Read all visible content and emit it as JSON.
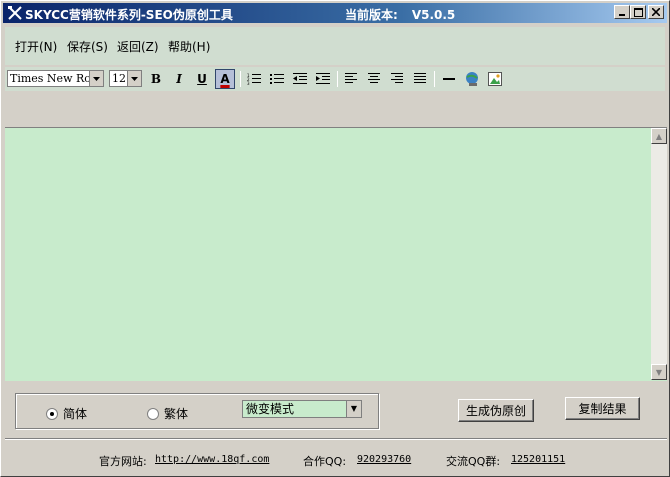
{
  "titlebar": {
    "title": "SKYCC营销软件系列-SEO伪原创工具",
    "version_label": "当前版本:",
    "version_value": "V5.0.5",
    "icon": "tools-icon"
  },
  "menu": {
    "items": [
      {
        "label": "打开(N)"
      },
      {
        "label": "保存(S)"
      },
      {
        "label": "返回(Z)"
      },
      {
        "label": "帮助(H)"
      }
    ]
  },
  "toolbar": {
    "font_family": "Times New Rom",
    "font_size": "12",
    "bold": "B",
    "italic": "I",
    "underline": "U",
    "font_color": "A"
  },
  "options": {
    "radio_simplified": "简体",
    "radio_traditional": "繁体",
    "mode_selected": "微变模式",
    "selected_radio": "简体"
  },
  "actions": {
    "generate_label": "生成伪原创",
    "copy_label": "复制结果"
  },
  "footer": {
    "site_label": "官方网站:",
    "site_url": "http://www.18qf.com",
    "qq_label": "合作QQ:",
    "qq_value": "920293760",
    "group_label": "交流QQ群:",
    "group_value": "125201151"
  },
  "colors": {
    "editor_bg": "#c8ebcc",
    "menu_bg": "#d0ddd0",
    "titlebar_start": "#0a246a"
  }
}
